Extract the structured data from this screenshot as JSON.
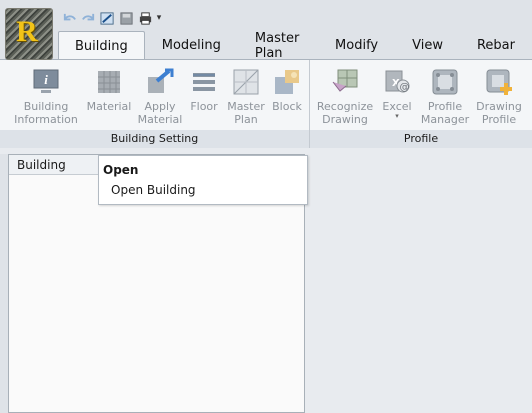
{
  "app": {
    "logo_letter": "R"
  },
  "quick_access": [
    {
      "name": "undo-icon"
    },
    {
      "name": "redo-icon"
    },
    {
      "name": "open-file-icon"
    },
    {
      "name": "save-icon"
    },
    {
      "name": "print-icon"
    },
    {
      "name": "customize-icon"
    }
  ],
  "tabs": [
    "Building",
    "Modeling",
    "Master Plan",
    "Modify",
    "View",
    "Rebar"
  ],
  "active_tab": "Building",
  "ribbon": {
    "groups": [
      {
        "label": "Building Setting",
        "buttons": [
          {
            "label": "Building\nInformation",
            "icon": "info-icon"
          },
          {
            "label": "Material",
            "icon": "material-icon"
          },
          {
            "label": "Apply\nMaterial",
            "icon": "apply-material-icon"
          },
          {
            "label": "Floor",
            "icon": "floor-icon"
          },
          {
            "label": "Master\nPlan",
            "icon": "master-plan-icon"
          },
          {
            "label": "Block",
            "icon": "block-icon"
          }
        ]
      },
      {
        "label": "Profile",
        "buttons": [
          {
            "label": "Recognize\nDrawing",
            "icon": "recognize-drawing-icon"
          },
          {
            "label": "Excel",
            "icon": "excel-icon"
          },
          {
            "label": "Profile\nManager",
            "icon": "profile-manager-icon"
          },
          {
            "label": "Drawing\nProfile",
            "icon": "drawing-profile-icon"
          }
        ]
      }
    ]
  },
  "left_panel": {
    "header": "Building"
  },
  "popup": {
    "title": "Open",
    "items": [
      "Open Building"
    ]
  },
  "colors": {
    "accent_blue": "#3d7fd1",
    "disabled_text": "#8d939a",
    "logo_gold": "#f2c318"
  }
}
